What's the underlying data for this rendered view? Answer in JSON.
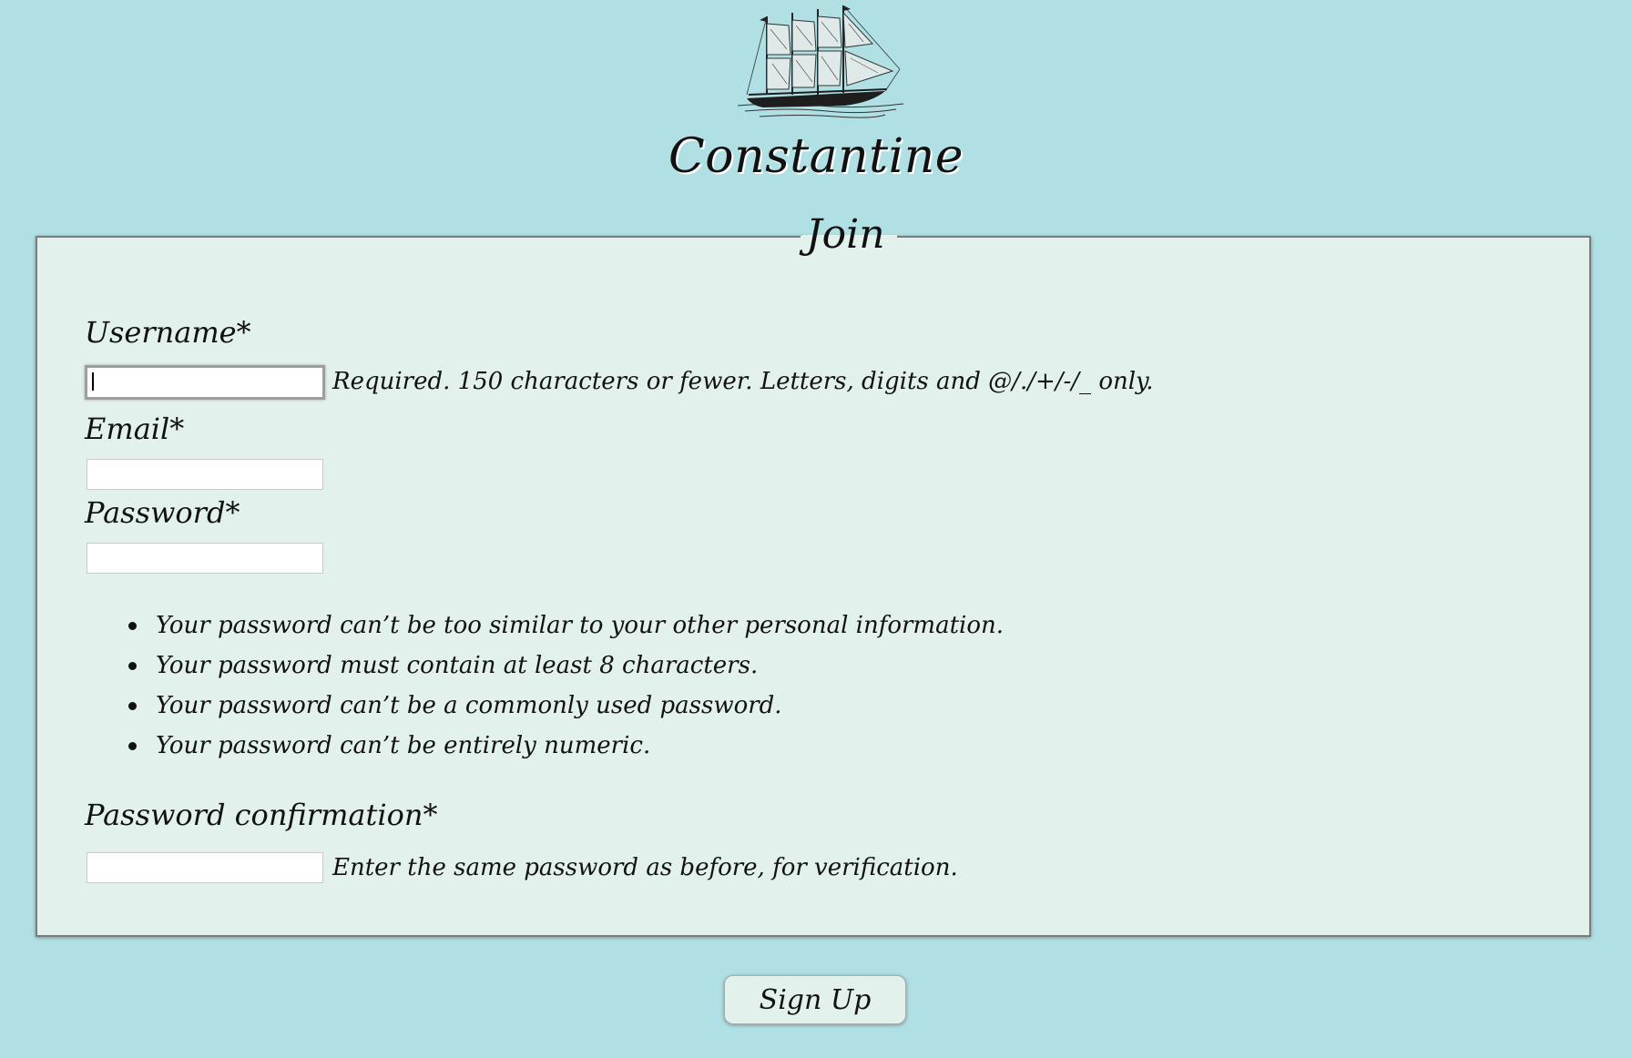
{
  "header": {
    "logo_icon": "sailing-ship-icon",
    "site_title": "Constantine"
  },
  "form": {
    "legend": "Join",
    "username": {
      "label": "Username*",
      "value": "",
      "help": "Required. 150 characters or fewer. Letters, digits and @/./+/-/_ only."
    },
    "email": {
      "label": "Email*",
      "value": ""
    },
    "password": {
      "label": "Password*",
      "value": "",
      "rules": [
        "Your password can’t be too similar to your other personal information.",
        "Your password must contain at least 8 characters.",
        "Your password can’t be a commonly used password.",
        "Your password can’t be entirely numeric."
      ]
    },
    "password_confirmation": {
      "label": "Password confirmation*",
      "value": "",
      "help": "Enter the same password as before, for verification."
    }
  },
  "actions": {
    "submit_label": "Sign Up"
  },
  "colors": {
    "page_background": "#b1e0e4",
    "panel_background": "#e2f1eb",
    "panel_border": "#7b7b7b",
    "text": "#111111"
  }
}
